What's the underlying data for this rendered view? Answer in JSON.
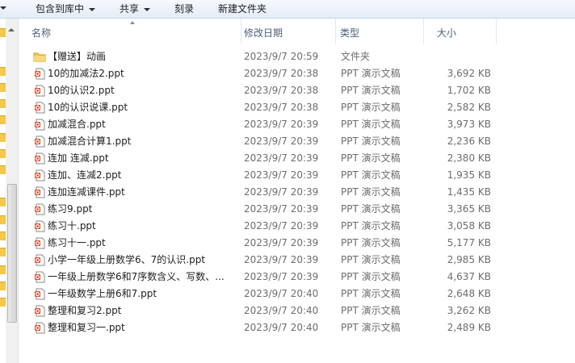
{
  "toolbar": {
    "include_label": "包含到库中",
    "share_label": "共享",
    "burn_label": "刻录",
    "new_folder_label": "新建文件夹"
  },
  "columns": {
    "name": "名称",
    "date": "修改日期",
    "type": "类型",
    "size": "大小"
  },
  "files": [
    {
      "name": "【赠送】动画",
      "date": "2023/9/7 20:59",
      "type": "文件夹",
      "size": "",
      "icon": "folder-icon"
    },
    {
      "name": "10的加减法2.ppt",
      "date": "2023/9/7 20:38",
      "type": "PPT 演示文稿",
      "size": "3,692 KB",
      "icon": "ppt-file-icon"
    },
    {
      "name": "10的认识2.ppt",
      "date": "2023/9/7 20:38",
      "type": "PPT 演示文稿",
      "size": "1,702 KB",
      "icon": "ppt-file-icon"
    },
    {
      "name": "10的认识说课.ppt",
      "date": "2023/9/7 20:38",
      "type": "PPT 演示文稿",
      "size": "2,582 KB",
      "icon": "ppt-file-icon"
    },
    {
      "name": "加减混合.ppt",
      "date": "2023/9/7 20:39",
      "type": "PPT 演示文稿",
      "size": "3,973 KB",
      "icon": "ppt-file-icon"
    },
    {
      "name": "加减混合计算1.ppt",
      "date": "2023/9/7 20:39",
      "type": "PPT 演示文稿",
      "size": "2,236 KB",
      "icon": "ppt-file-icon"
    },
    {
      "name": "连加 连减.ppt",
      "date": "2023/9/7 20:39",
      "type": "PPT 演示文稿",
      "size": "2,380 KB",
      "icon": "ppt-file-icon"
    },
    {
      "name": "连加、连减2.ppt",
      "date": "2023/9/7 20:39",
      "type": "PPT 演示文稿",
      "size": "1,935 KB",
      "icon": "ppt-file-icon"
    },
    {
      "name": "连加连减课件.ppt",
      "date": "2023/9/7 20:39",
      "type": "PPT 演示文稿",
      "size": "1,435 KB",
      "icon": "ppt-file-icon"
    },
    {
      "name": "练习9.ppt",
      "date": "2023/9/7 20:39",
      "type": "PPT 演示文稿",
      "size": "3,365 KB",
      "icon": "ppt-file-icon"
    },
    {
      "name": "练习十.ppt",
      "date": "2023/9/7 20:39",
      "type": "PPT 演示文稿",
      "size": "3,058 KB",
      "icon": "ppt-file-icon"
    },
    {
      "name": "练习十一.ppt",
      "date": "2023/9/7 20:39",
      "type": "PPT 演示文稿",
      "size": "5,177 KB",
      "icon": "ppt-file-icon"
    },
    {
      "name": "小学一年级上册数学6、7的认识.ppt",
      "date": "2023/9/7 20:39",
      "type": "PPT 演示文稿",
      "size": "2,985 KB",
      "icon": "ppt-file-icon"
    },
    {
      "name": "一年级上册数学6和7序数含义、写数、...",
      "date": "2023/9/7 20:39",
      "type": "PPT 演示文稿",
      "size": "4,637 KB",
      "icon": "ppt-file-icon"
    },
    {
      "name": "一年级数学上册6和7.ppt",
      "date": "2023/9/7 20:40",
      "type": "PPT 演示文稿",
      "size": "2,648 KB",
      "icon": "ppt-file-icon"
    },
    {
      "name": "整理和复习2.ppt",
      "date": "2023/9/7 20:40",
      "type": "PPT 演示文稿",
      "size": "3,262 KB",
      "icon": "ppt-file-icon"
    },
    {
      "name": "整理和复习一.ppt",
      "date": "2023/9/7 20:40",
      "type": "PPT 演示文稿",
      "size": "2,489 KB",
      "icon": "ppt-file-icon"
    }
  ]
}
